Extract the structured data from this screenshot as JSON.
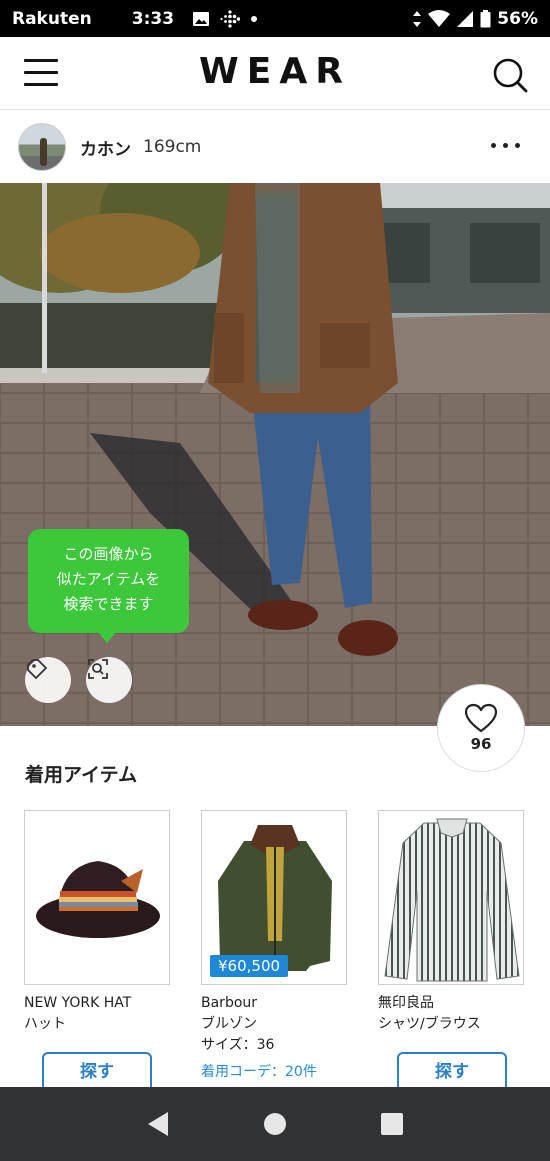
{
  "status_bar": {
    "carrier": "Rakuten",
    "time": "3:33",
    "battery": "56%"
  },
  "header": {
    "logo": "WEAR"
  },
  "user": {
    "name": "カホン",
    "height": "169cm"
  },
  "photo": {
    "tooltip_lines": [
      "この画像から",
      "似たアイテムを",
      "検索できます"
    ]
  },
  "like": {
    "count": "96"
  },
  "items_section": {
    "title": "着用アイテム",
    "items": [
      {
        "brand": "NEW YORK HAT",
        "category": "ハット",
        "button": "探す"
      },
      {
        "brand": "Barbour",
        "category": "ブルゾン",
        "size": "サイズ：36",
        "price": "¥60,500",
        "coord_link": "着用コーデ：20件"
      },
      {
        "brand": "無印良品",
        "category": "シャツ/ブラウス",
        "button": "探す"
      }
    ]
  },
  "icons": {
    "menu": "hamburger-menu-icon",
    "search": "search-icon",
    "more": "more-dots-icon",
    "tag": "tag-icon",
    "image_search": "image-search-icon",
    "heart": "heart-icon",
    "nav_back": "back-triangle-icon",
    "nav_home": "home-circle-icon",
    "nav_recents": "recents-square-icon"
  },
  "colors": {
    "accent_green": "#3cc83a",
    "link_blue": "#2a7fc9",
    "price_blue": "#1e88d6"
  }
}
